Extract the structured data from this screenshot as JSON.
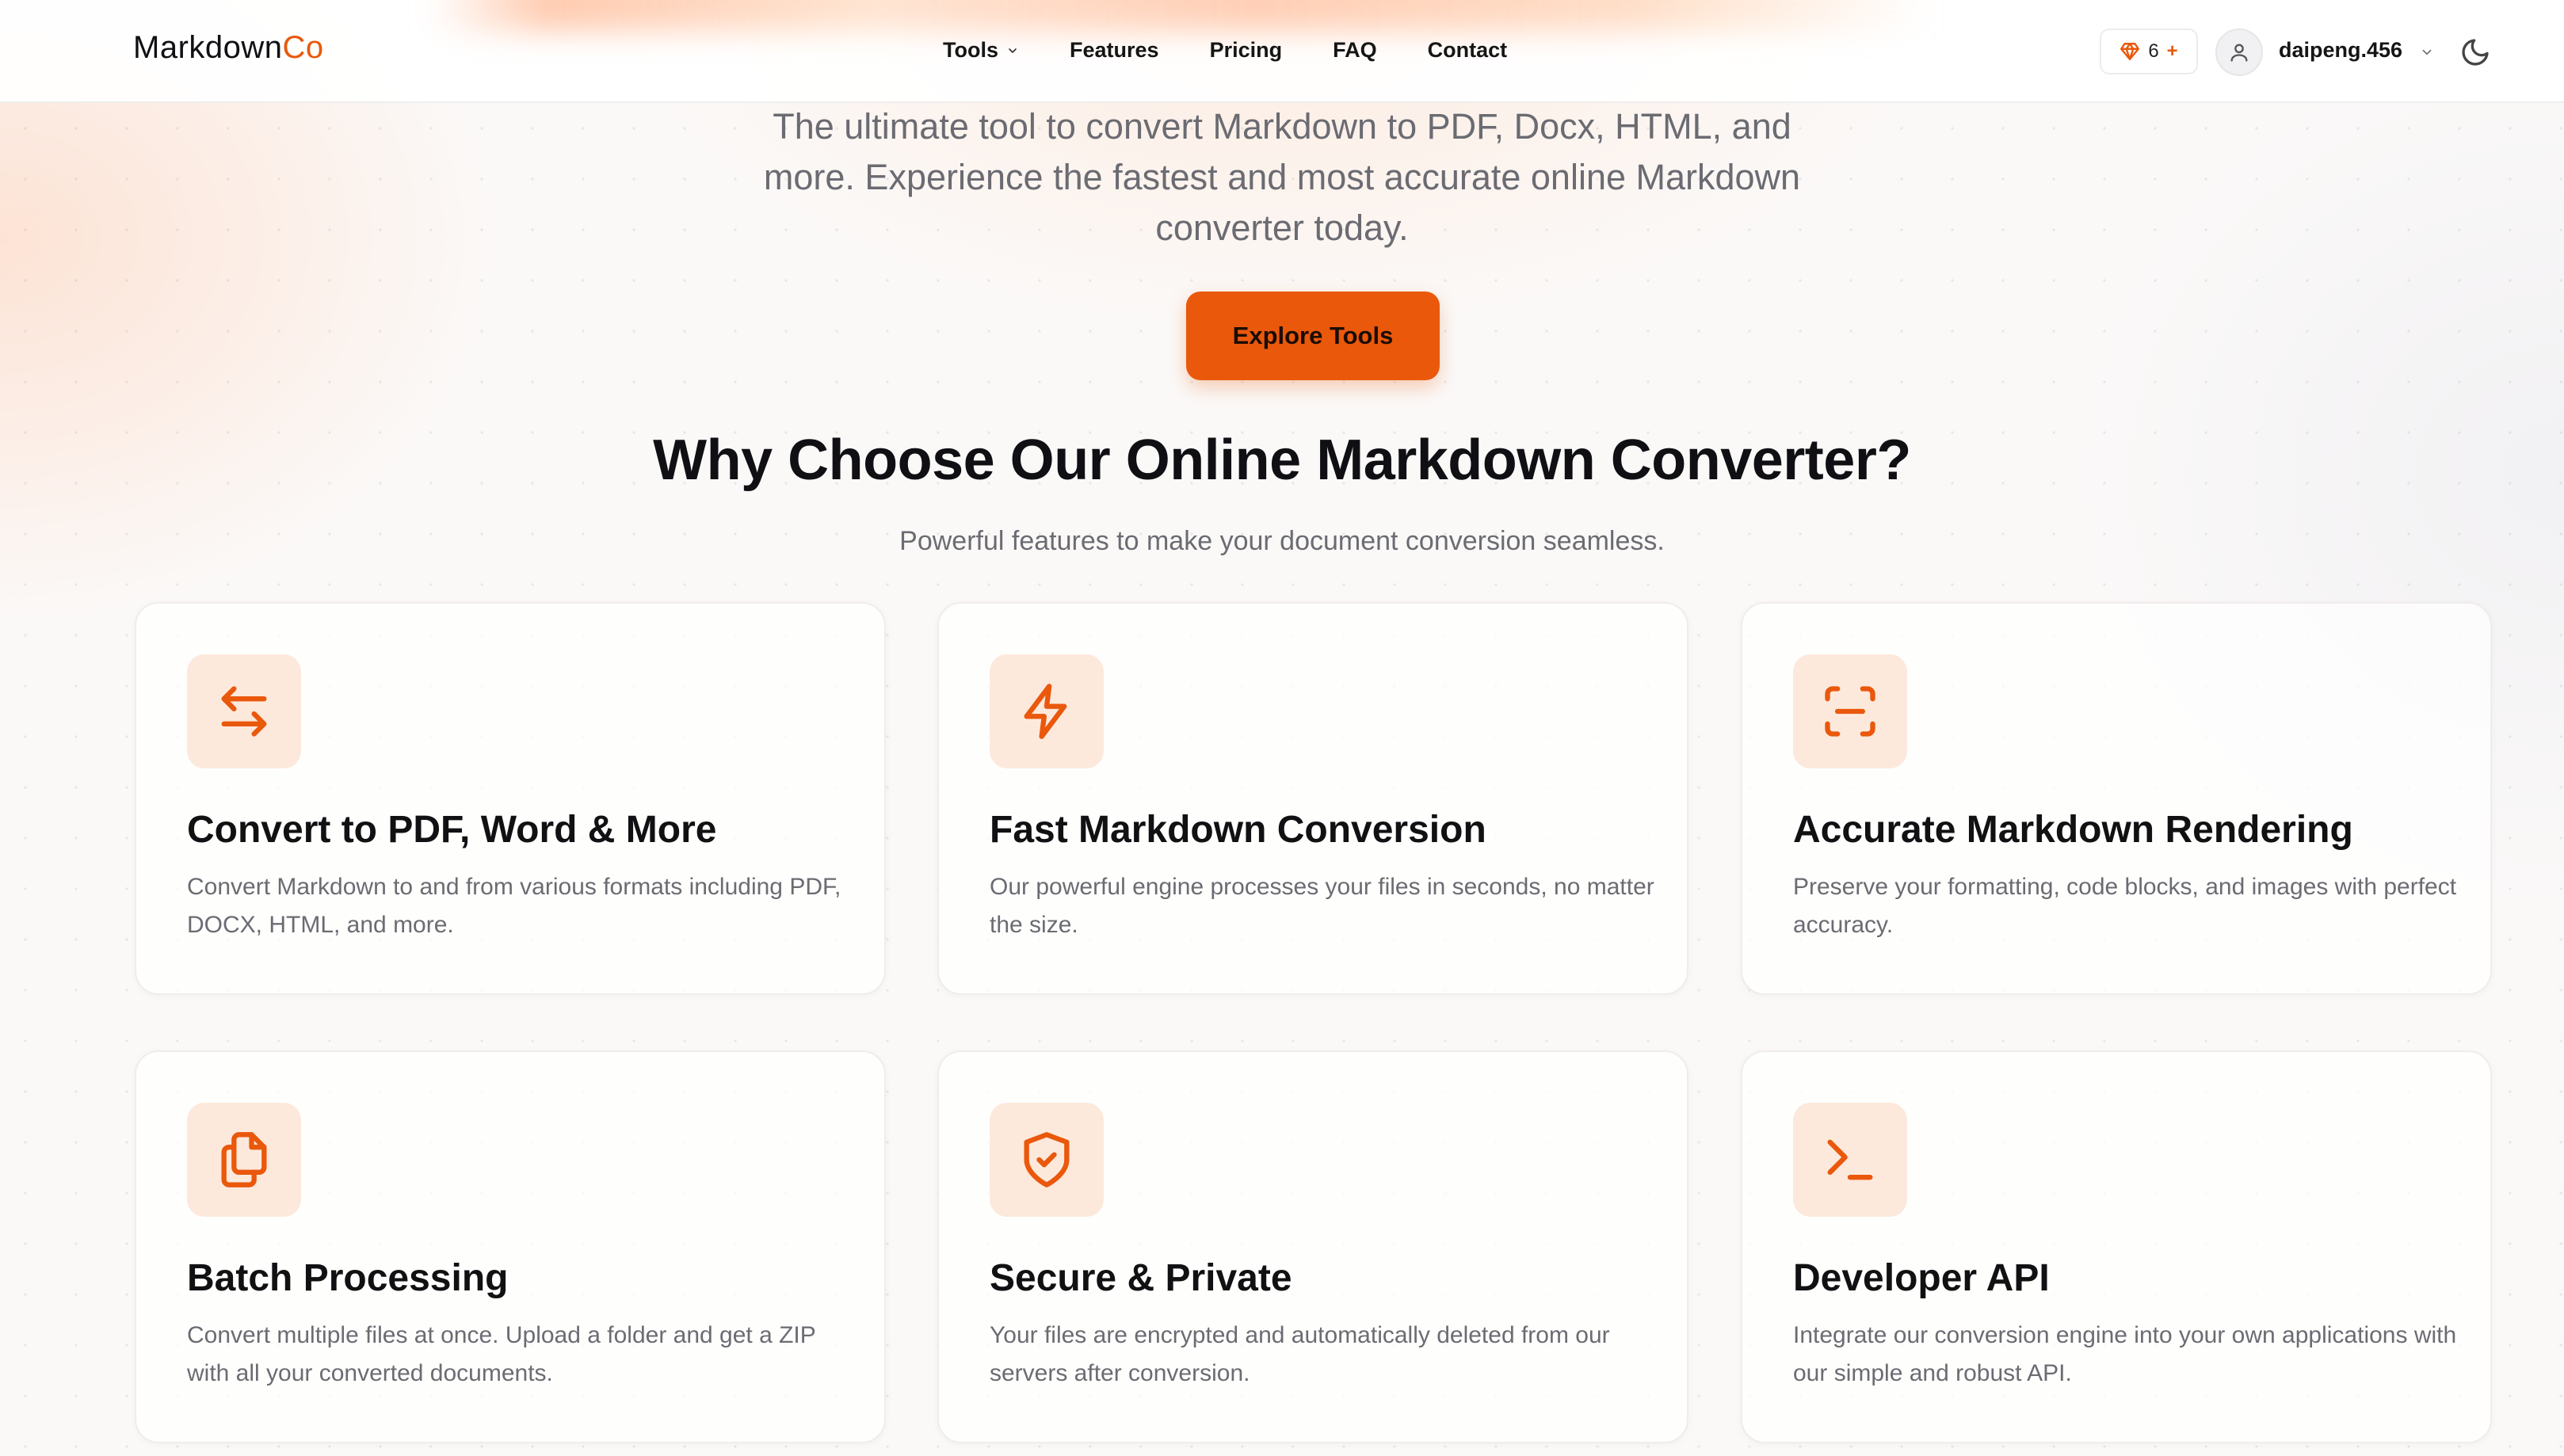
{
  "header": {
    "logo_main": "Markdown",
    "logo_accent": "Co",
    "nav": [
      {
        "label": "Tools"
      },
      {
        "label": "Features"
      },
      {
        "label": "Pricing"
      },
      {
        "label": "FAQ"
      },
      {
        "label": "Contact"
      }
    ],
    "credits": {
      "count": "6",
      "plus": "+"
    },
    "username": "daipeng.456"
  },
  "hero": {
    "description": "The ultimate tool to convert Markdown to PDF, Docx, HTML, and more. Experience the fastest and most accurate online Markdown converter today.",
    "cta_label": "Explore Tools"
  },
  "features": {
    "title": "Why Choose Our Online Markdown Converter?",
    "subtitle": "Powerful features to make your document conversion seamless.",
    "items": [
      {
        "icon": "arrows-swap-icon",
        "title": "Convert to PDF, Word & More",
        "description": "Convert Markdown to and from various formats including PDF, DOCX, HTML, and more."
      },
      {
        "icon": "lightning-icon",
        "title": "Fast Markdown Conversion",
        "description": "Our powerful engine processes your files in seconds, no matter the size."
      },
      {
        "icon": "scan-icon",
        "title": "Accurate Markdown Rendering",
        "description": "Preserve your formatting, code blocks, and images with perfect accuracy."
      },
      {
        "icon": "files-icon",
        "title": "Batch Processing",
        "description": "Convert multiple files at once. Upload a folder and get a ZIP with all your converted documents."
      },
      {
        "icon": "shield-check-icon",
        "title": "Secure & Private",
        "description": "Your files are encrypted and automatically deleted from our servers after conversion."
      },
      {
        "icon": "terminal-icon",
        "title": "Developer API",
        "description": "Integrate our conversion engine into your own applications with our simple and robust API."
      }
    ]
  },
  "colors": {
    "accent": "#ea580c",
    "icon_bg": "#fde9dc",
    "muted_text": "#6b6b72"
  }
}
